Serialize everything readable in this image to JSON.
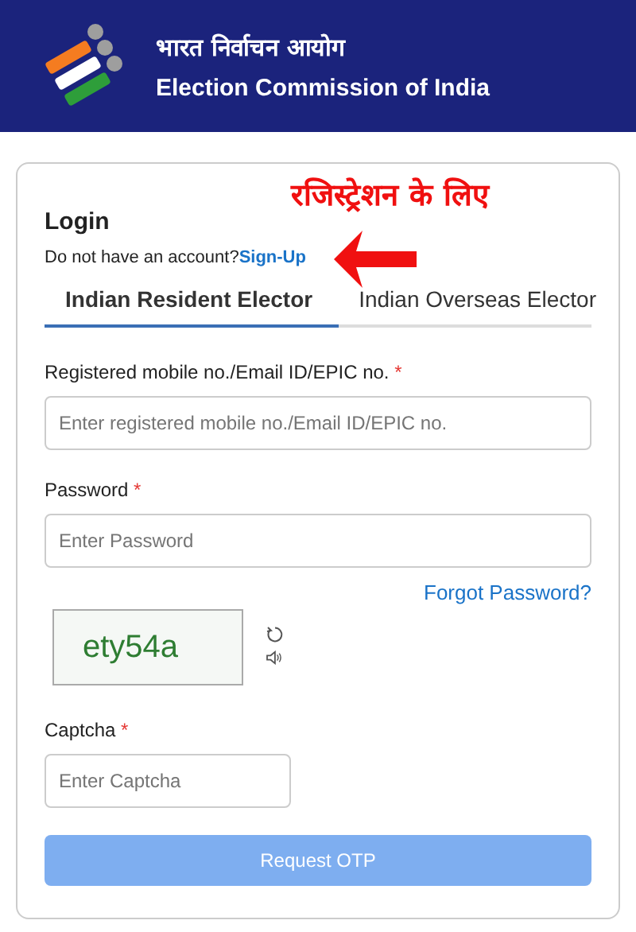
{
  "header": {
    "title_hindi": "भारत निर्वाचन आयोग",
    "title": "Election Commission of India"
  },
  "annotation": {
    "text": "रजिस्ट्रेशन के लिए"
  },
  "login": {
    "title": "Login",
    "prompt": "Do not have an account?",
    "signup_link": "Sign-Up"
  },
  "tabs": [
    {
      "label": "Indian Resident Elector",
      "selected": true
    },
    {
      "label": "Indian Overseas Elector",
      "selected": false
    }
  ],
  "fields": [
    {
      "label": "Registered mobile no./Email ID/EPIC no.",
      "required_mark": "*",
      "placeholder": "Enter registered mobile no./Email ID/EPIC no."
    },
    {
      "label": "Password",
      "required_mark": "*",
      "placeholder": "Enter Password"
    }
  ],
  "forgot_password": "Forgot Password?",
  "captcha": {
    "image_text": "ety54a",
    "label": "Captcha",
    "required_mark": "*",
    "placeholder": "Enter Captcha"
  },
  "submit": {
    "label": "Request OTP",
    "disabled": true
  }
}
